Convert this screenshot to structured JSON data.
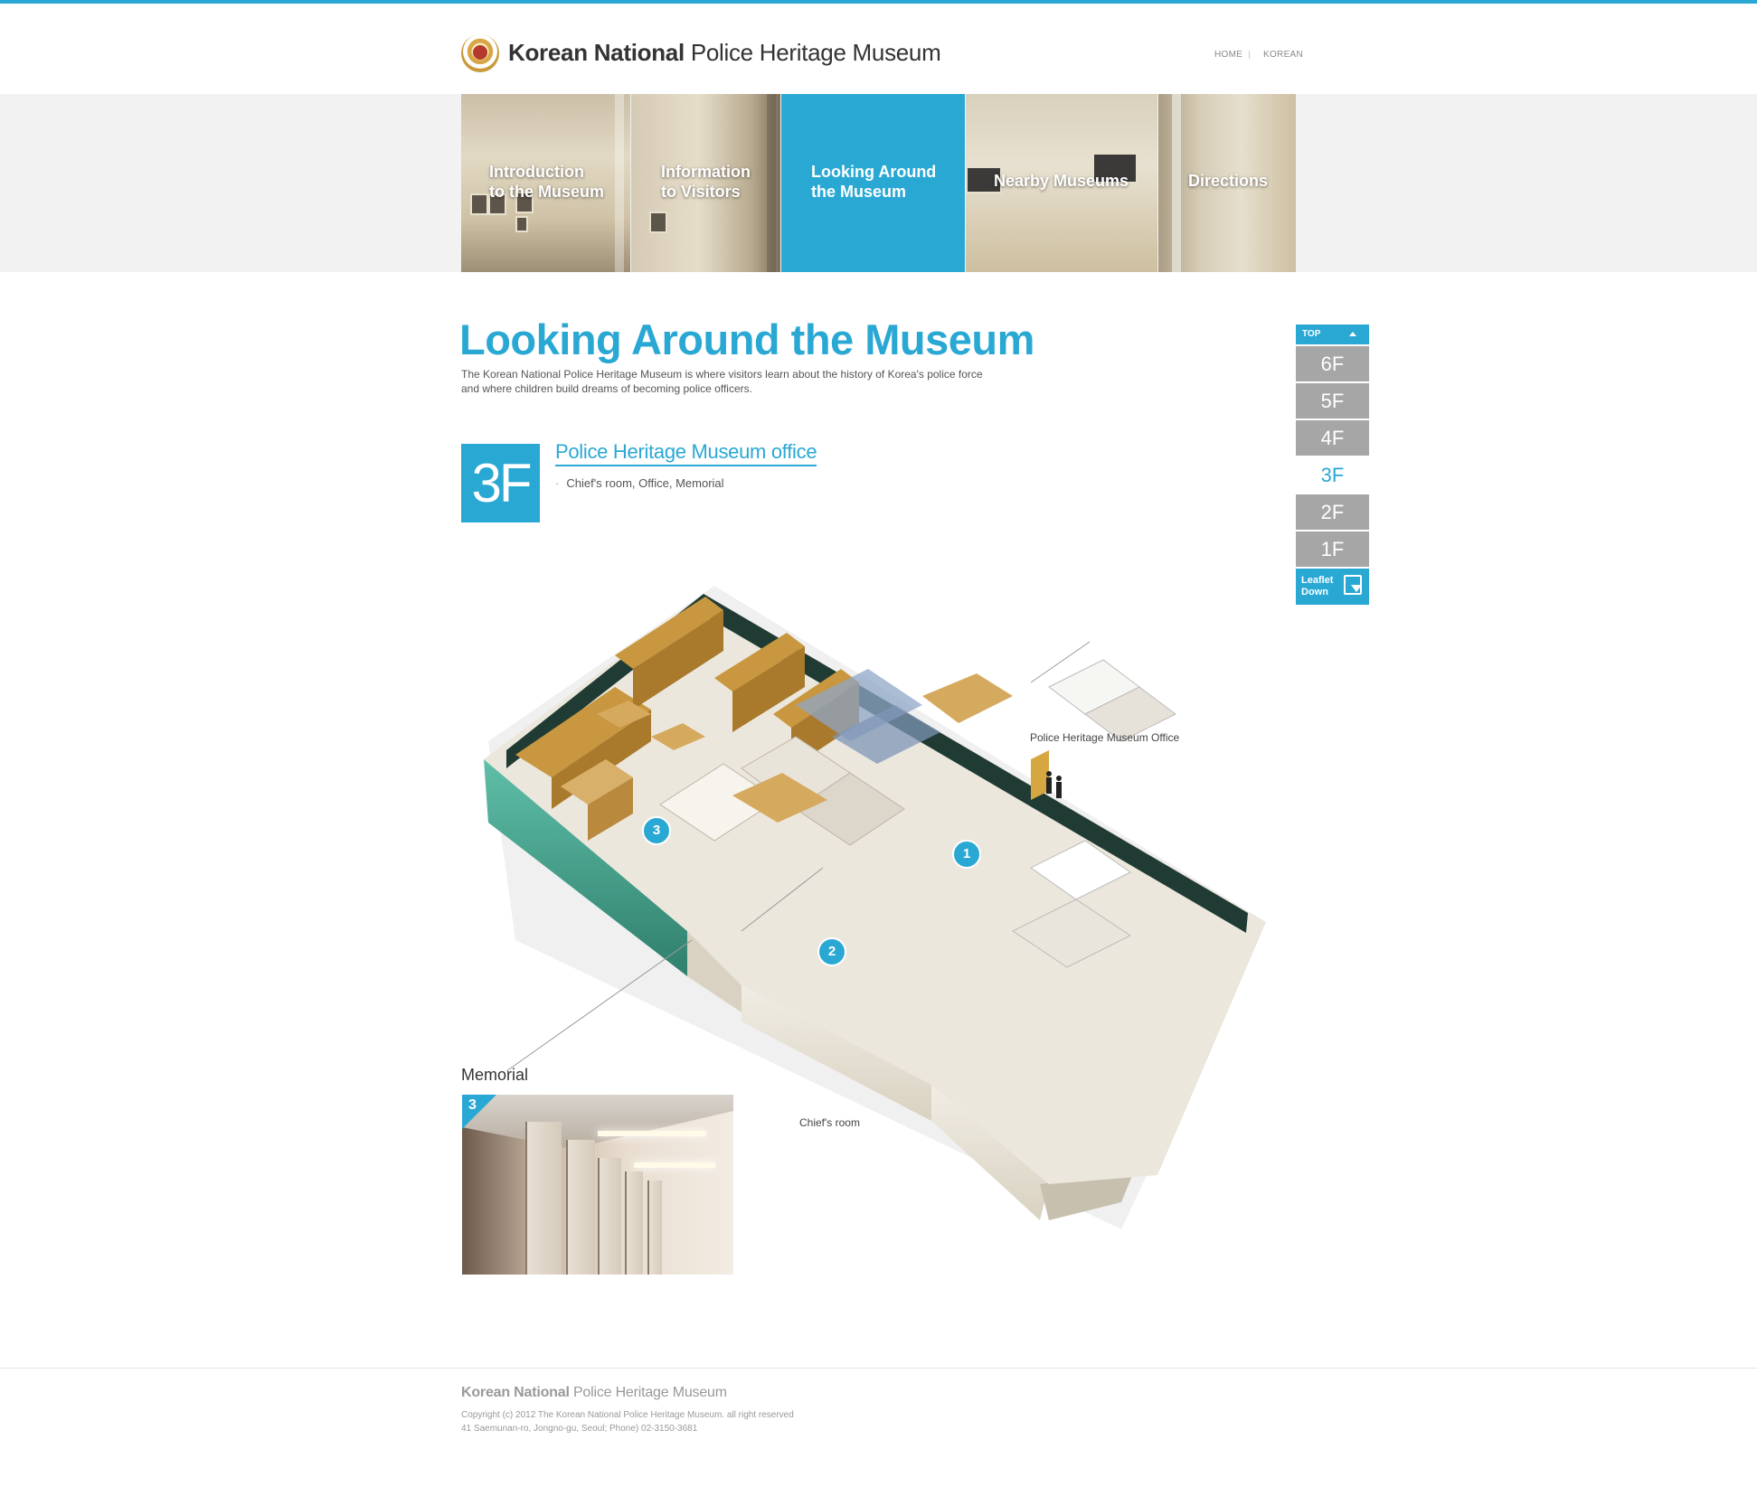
{
  "header": {
    "title_bold": "Korean National",
    "title_regular": "Police Heritage Museum",
    "util_links": [
      "HOME",
      "KOREAN"
    ]
  },
  "nav": {
    "items": [
      {
        "line1": "Introduction",
        "line2": "to the Museum"
      },
      {
        "line1": "Information",
        "line2": "to Visitors"
      },
      {
        "line1": "Looking Around",
        "line2": "the Museum"
      },
      {
        "line1": "Nearby Museums",
        "line2": ""
      },
      {
        "line1": "Directions",
        "line2": ""
      }
    ],
    "active_index": 2
  },
  "main": {
    "title": "Looking Around the Museum",
    "intro_line1": "The Korean National Police Heritage Museum is where visitors learn about the history of Korea's police force",
    "intro_line2": "and where children build dreams of becoming police officers."
  },
  "floor_section": {
    "badge": "3F",
    "title": "Police Heritage Museum office",
    "bullet": "·",
    "items": "Chief's room, Office, Memorial"
  },
  "plan": {
    "callouts": {
      "office": "Police Heritage Museum Office",
      "chief": "Chief's room"
    },
    "markers": [
      "1",
      "2",
      "3"
    ]
  },
  "memorial": {
    "label": "Memorial",
    "badge": "3"
  },
  "side_nav": {
    "top_label": "TOP",
    "floors": [
      "6F",
      "5F",
      "4F",
      "3F",
      "2F",
      "1F"
    ],
    "active_floor": "3F",
    "leaflet_line1": "Leaflet",
    "leaflet_line2": "Down"
  },
  "footer": {
    "title_bold": "Korean National",
    "title_regular": "Police Heritage Museum",
    "copyright": "Copyright (c) 2012 The Korean National Police Heritage Museum. all right reserved",
    "address": "41 Saemunan-ro, Jongno-gu, Seoul; Phone) 02-3150-3681"
  },
  "colors": {
    "accent": "#2aa8d4",
    "side_inactive": "#a6a6a6",
    "glass_green": "#3f9e8a"
  }
}
